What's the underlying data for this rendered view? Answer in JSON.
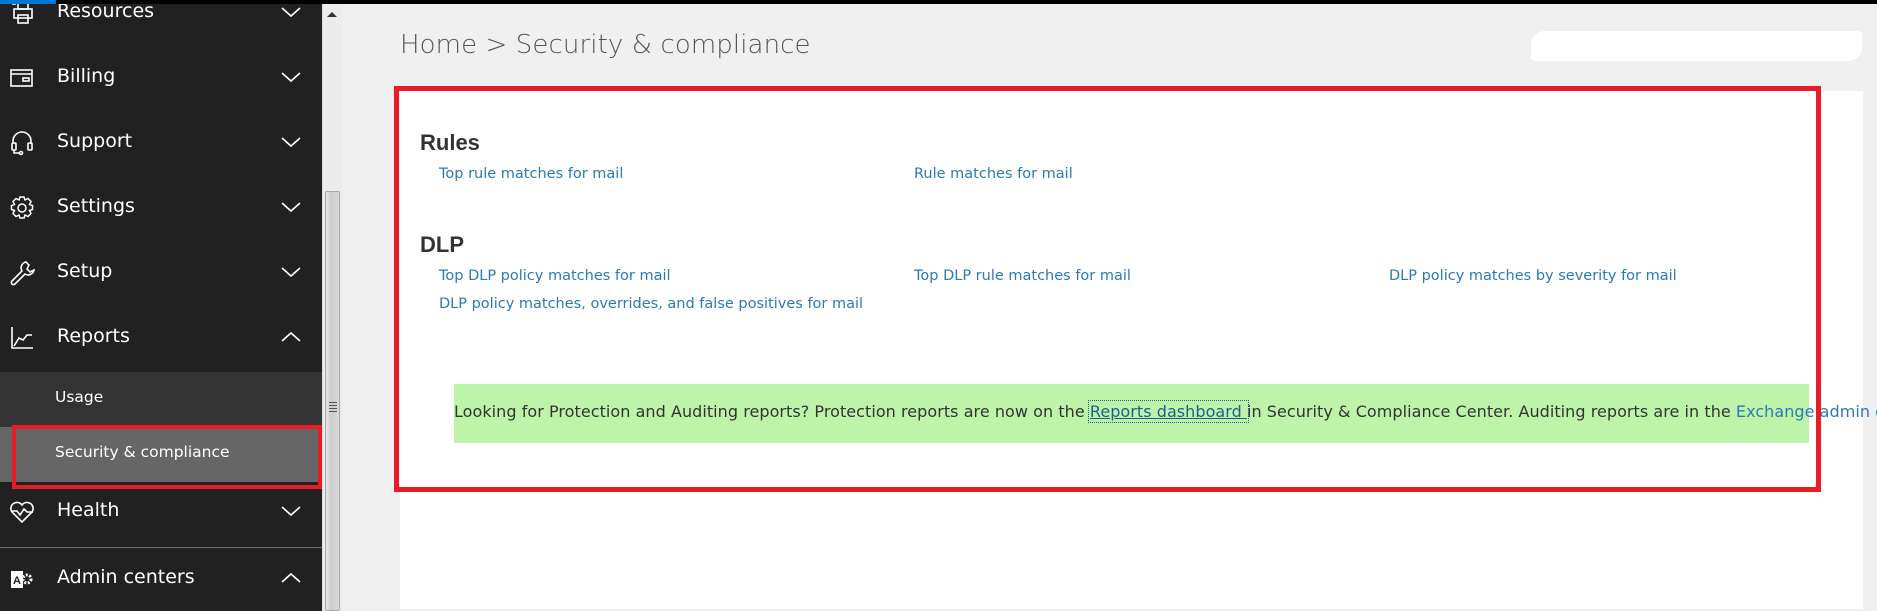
{
  "sidebar": {
    "items": [
      {
        "label": "Resources",
        "icon": "printer-icon",
        "expanded": false
      },
      {
        "label": "Billing",
        "icon": "billing-card-icon",
        "expanded": false
      },
      {
        "label": "Support",
        "icon": "headset-icon",
        "expanded": false
      },
      {
        "label": "Settings",
        "icon": "gear-icon",
        "expanded": false
      },
      {
        "label": "Setup",
        "icon": "wrench-icon",
        "expanded": false
      },
      {
        "label": "Reports",
        "icon": "chart-line-icon",
        "expanded": true
      },
      {
        "label": "Health",
        "icon": "heart-pulse-icon",
        "expanded": false
      },
      {
        "label": "Admin centers",
        "icon": "admin-centers-icon",
        "expanded": true
      }
    ],
    "reports_subitems": [
      {
        "label": "Usage",
        "selected": false
      },
      {
        "label": "Security & compliance",
        "selected": true
      }
    ]
  },
  "header": {
    "breadcrumb": "Home > Security & compliance"
  },
  "main": {
    "sections": [
      {
        "title": "Rules",
        "links": [
          "Top rule matches for mail",
          "Rule matches for mail"
        ]
      },
      {
        "title": "DLP",
        "links": [
          "Top DLP policy matches for mail",
          "Top DLP rule matches for mail",
          "DLP policy matches by severity for mail",
          "DLP policy matches, overrides, and false positives for mail"
        ]
      }
    ],
    "notice": {
      "text_before": "Looking for Protection and Auditing reports? Protection reports are now on the ",
      "link1": "Reports dashboard ",
      "text_middle": "in Security & Compliance Center. Auditing reports are in the ",
      "link2": "Exchange admin center",
      "text_after": "."
    }
  },
  "colors": {
    "sidebar_bg": "#212121",
    "selected_bg": "#666666",
    "highlight_red": "#e81c24",
    "link_blue": "#2a7ab8",
    "notice_green": "#bdf4aa",
    "accent_blue": "#0078d7"
  }
}
